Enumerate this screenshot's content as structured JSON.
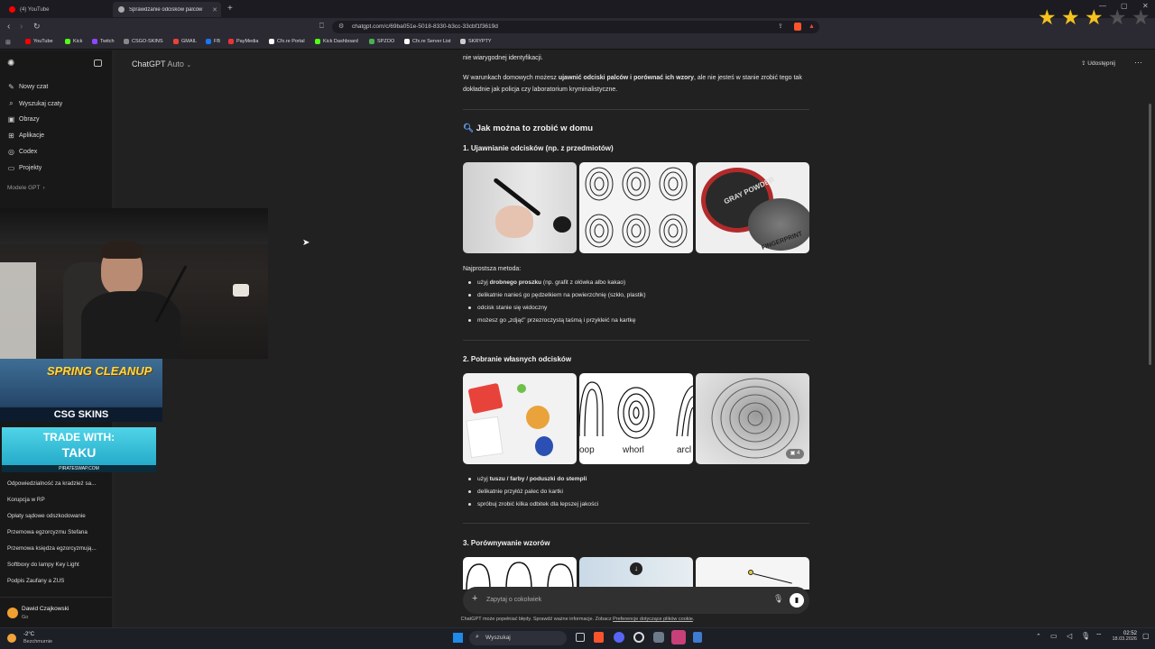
{
  "browser": {
    "tabs": [
      {
        "label": "(4) YouTube",
        "active": false,
        "color": "#ff0000"
      },
      {
        "label": "Sprawdzanie odcisków palców",
        "active": true,
        "color": "#aaaaaa"
      }
    ],
    "url": "chatgpt.com/c/69ba051e-5018-8330-b3cc-33cbf1f3619d",
    "bookmarks": [
      {
        "label": "YouTube",
        "color": "#ff0000"
      },
      {
        "label": "Kick",
        "color": "#53fc18"
      },
      {
        "label": "Twitch",
        "color": "#9146ff"
      },
      {
        "label": "CSGO-SKINS",
        "color": "#888888"
      },
      {
        "label": "GMAIL",
        "color": "#ea4335"
      },
      {
        "label": "FB",
        "color": "#1877f2"
      },
      {
        "label": "PayMedia",
        "color": "#e33"
      },
      {
        "label": "Cfx.re Portal",
        "color": "#ffffff"
      },
      {
        "label": "Kick Dashboard",
        "color": "#53fc18"
      },
      {
        "label": "SPZOO",
        "color": "#4caf50"
      },
      {
        "label": "Cfx.re Server List",
        "color": "#ffffff"
      },
      {
        "label": "SKRYPTY",
        "color": "#cccccc"
      }
    ]
  },
  "stars": {
    "filled": 3,
    "total": 5
  },
  "sidebar": {
    "items": [
      {
        "label": "Nowy czat",
        "icon": "compose-icon"
      },
      {
        "label": "Wyszukaj czaty",
        "icon": "search-icon"
      },
      {
        "label": "Obrazy",
        "icon": "image-icon"
      },
      {
        "label": "Aplikacje",
        "icon": "apps-icon"
      },
      {
        "label": "Codex",
        "icon": "codex-icon"
      },
      {
        "label": "Projekty",
        "icon": "folder-icon"
      }
    ],
    "section": "Modele GPT",
    "chats": [
      "Odpowiedzialność za kradzież sa...",
      "Korupcja w RP",
      "Opłaty sądowe odszkodowanie",
      "Przemowa egzorcyzmu Stefana",
      "Przemowa księdza egzorcyzmują...",
      "Softboxy do lampy Key Light",
      "Podpis Zaufany a ZUS"
    ],
    "user": {
      "name": "Dawid Czajkowski",
      "plan": "Go"
    }
  },
  "overlay": {
    "promo1": {
      "title": "SPRING CLEANUP",
      "brand": "CSG SKINS"
    },
    "promo2": {
      "line1": "TRADE WITH:",
      "line2": "TAKU",
      "site": "PIRATESWAP.COM"
    }
  },
  "header": {
    "model": "ChatGPT",
    "mode": "Auto",
    "share": "Udostępnij"
  },
  "content": {
    "intro_tail": "nie wiarygodnej identyfikacji.",
    "para_pre": "W warunkach domowych możesz ",
    "para_bold": "ujawnić odciski palców i porównać ich wzory",
    "para_post": ", ale nie jesteś w stanie zrobić tego tak dokładnie jak policja czy laboratorium kryminalistyczne.",
    "heading": "Jak można to zrobić w domu",
    "s1": "1. Ujawnianie odcisków (np. z przedmiotów)",
    "simplest": "Najprostsza metoda:",
    "s1_items": [
      {
        "pre": "użyj ",
        "bold": "drobnego proszku",
        "post": " (np. grafit z ołówka albo kakao)"
      },
      {
        "pre": "delikatnie nanieś go pędzelkiem na powierzchnię (szkło, plastik)",
        "bold": "",
        "post": ""
      },
      {
        "pre": "odcisk stanie się widoczny",
        "bold": "",
        "post": ""
      },
      {
        "pre": "możesz go „zdjąć” przezroczystą taśmą i przykleić na kartkę",
        "bold": "",
        "post": ""
      }
    ],
    "img_powder_label": "GRAY POWDER",
    "img_powder_label2": "FINGERPRINT",
    "s2": "2. Pobranie własnych odcisków",
    "img_loop": "oop",
    "img_whorl": "whorl",
    "img_arch": "arcl",
    "img_more": "4",
    "s2_items": [
      {
        "pre": "użyj ",
        "bold": "tuszu / farby / poduszki do stempli",
        "post": ""
      },
      {
        "pre": "delikatnie przyłóż palec do kartki",
        "bold": "",
        "post": ""
      },
      {
        "pre": "spróbuj zrobić kilka odbitek dla lepszej jakości",
        "bold": "",
        "post": ""
      }
    ],
    "s3": "3. Porównywanie wzorów"
  },
  "composer": {
    "placeholder": "Zapytaj o cokolwiek"
  },
  "disclaimer": {
    "pre": "ChatGPT może popełniać błędy. Sprawdź ważne informacje. Zobacz ",
    "link": "Preferencje dotyczące plików cookie",
    "post": "."
  },
  "taskbar": {
    "weather_temp": "-2°C",
    "weather_desc": "Bezchmurnie",
    "search": "Wyszukaj",
    "time": "02:52",
    "date": "18.03.2026"
  }
}
